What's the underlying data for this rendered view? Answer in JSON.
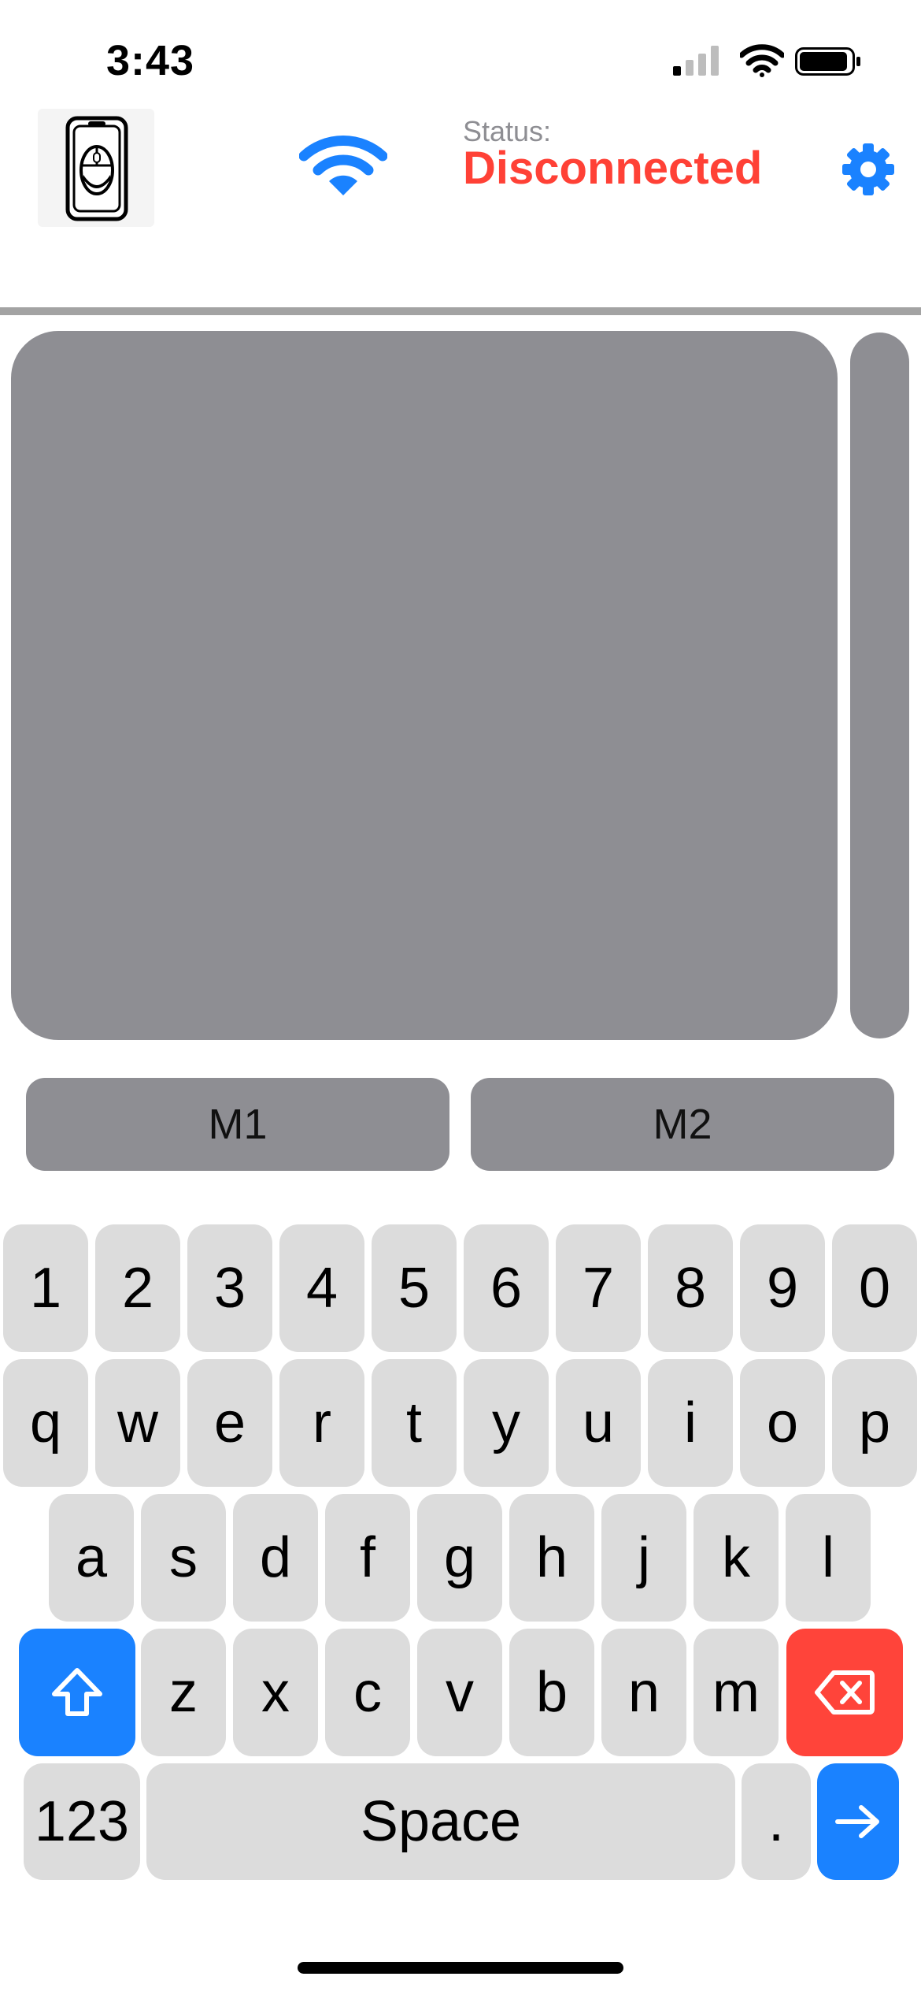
{
  "status_bar": {
    "time": "3:43"
  },
  "header": {
    "status_label": "Status:",
    "status_value": "Disconnected",
    "status_color": "#ff4136",
    "accent_color": "#1a82ff",
    "icons": [
      "app-logo-icon",
      "wifi-icon",
      "gear-icon"
    ]
  },
  "mouse_buttons": {
    "m1": "M1",
    "m2": "M2"
  },
  "keyboard": {
    "row1": [
      "1",
      "2",
      "3",
      "4",
      "5",
      "6",
      "7",
      "8",
      "9",
      "0"
    ],
    "row2": [
      "q",
      "w",
      "e",
      "r",
      "t",
      "y",
      "u",
      "i",
      "o",
      "p"
    ],
    "row3": [
      "a",
      "s",
      "d",
      "f",
      "g",
      "h",
      "j",
      "k",
      "l"
    ],
    "row4": [
      "z",
      "x",
      "c",
      "v",
      "b",
      "n",
      "m"
    ],
    "numbers_key": "123",
    "space_key": "Space",
    "period_key": "."
  }
}
